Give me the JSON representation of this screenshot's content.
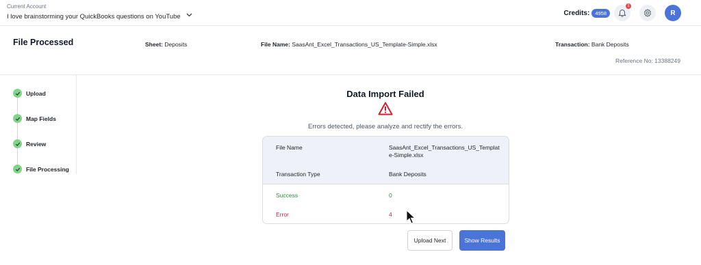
{
  "account": {
    "caption": "Current Account",
    "name": "I love brainstorming your QuickBooks questions on YouTube",
    "dropdown_icon": "chevron-down-icon"
  },
  "toolbar": {
    "credits_label": "Credits:",
    "credits_value": "4958",
    "notification_count": "1",
    "avatar_initial": "R",
    "accent_color": "#4b74d8"
  },
  "header": {
    "title": "File Processed",
    "sheet_label": "Sheet:",
    "sheet_value": "Deposits",
    "file_label": "File Name:",
    "file_value": "SaasAnt_Excel_Transactions_US_Template-Simple.xlsx",
    "transaction_label": "Transaction:",
    "transaction_value": "Bank Deposits",
    "reference": "Reference No: 13388249"
  },
  "steps": [
    {
      "label": "Upload",
      "status": "done"
    },
    {
      "label": "Map Fields",
      "status": "done"
    },
    {
      "label": "Review",
      "status": "done"
    },
    {
      "label": "File Processing",
      "status": "done"
    }
  ],
  "result": {
    "title": "Data Import Failed",
    "status_icon": "warning-triangle-icon",
    "message": "Errors detected, please analyze and rectify the errors.",
    "rows": [
      {
        "key": "File Name",
        "value": "SaasAnt_Excel_Transactions_US_Templat e-Simple.xlsx"
      },
      {
        "key": "Transaction Type",
        "value": "Bank Deposits"
      },
      {
        "key": "Success",
        "value": "0"
      },
      {
        "key": "Error",
        "value": "4"
      }
    ],
    "success_color": "#2e8b3a",
    "error_color": "#c8233a"
  },
  "actions": {
    "upload_next": "Upload Next",
    "show_results": "Show Results"
  }
}
